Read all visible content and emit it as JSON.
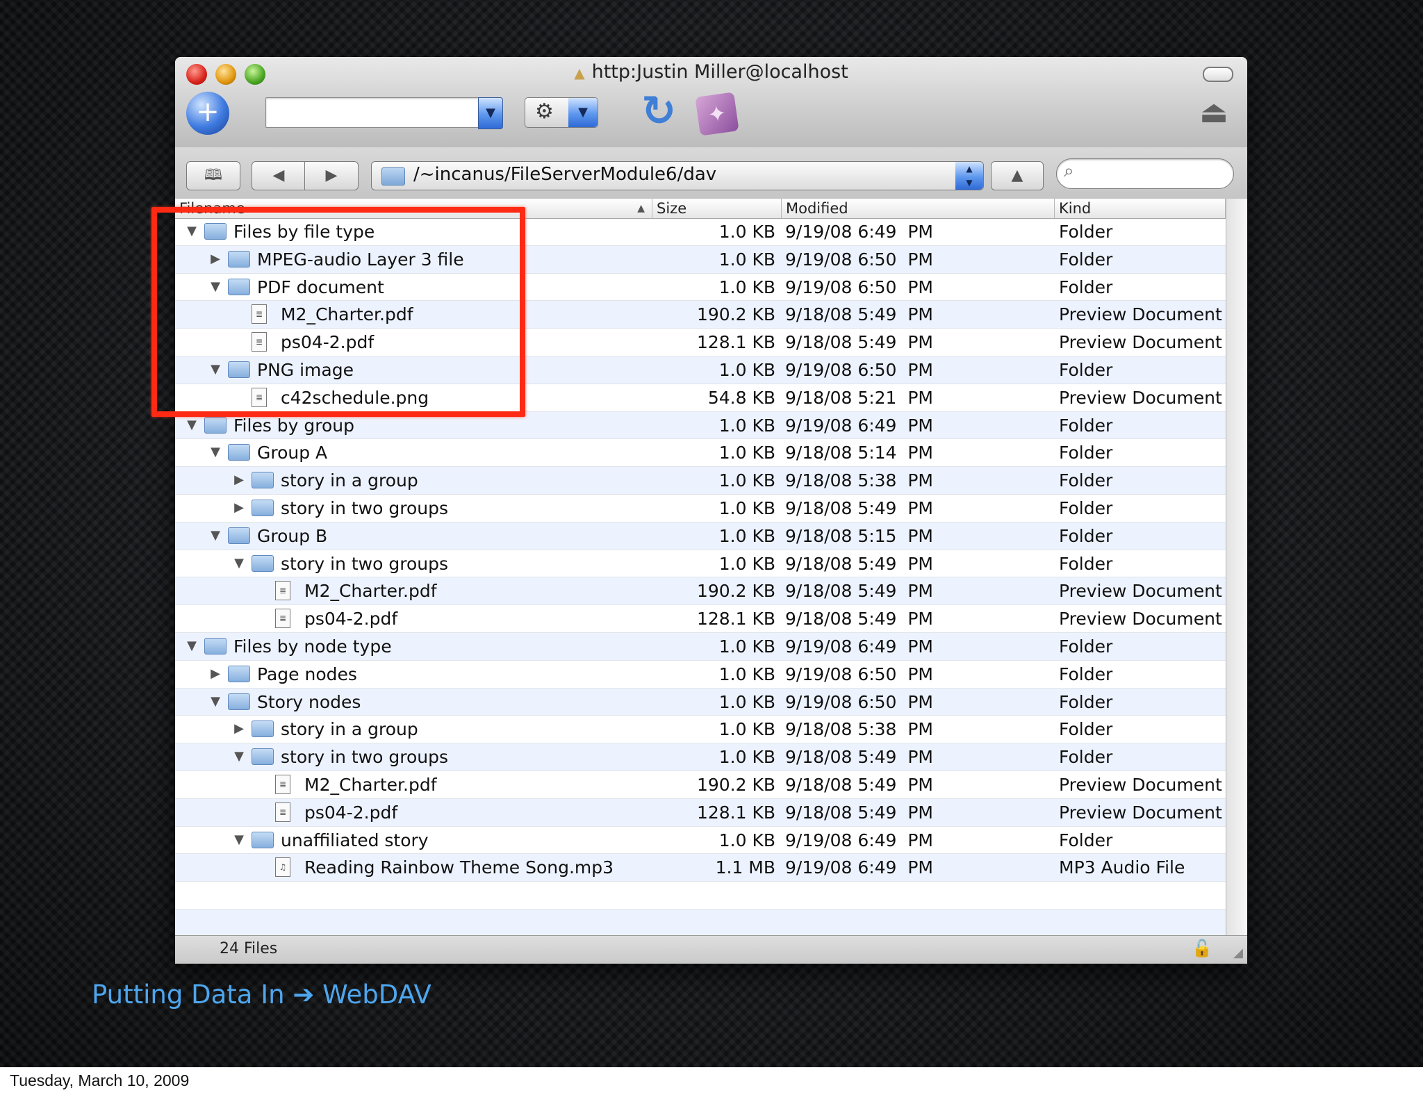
{
  "window": {
    "title": "http:Justin Miller@localhost",
    "path": "/~incanus/FileServerModule6/dav",
    "status": "24 Files"
  },
  "columns": {
    "filename": "Filename",
    "size": "Size",
    "modified": "Modified",
    "kind": "Kind"
  },
  "rows": [
    {
      "name": "Files by file type",
      "level": 0,
      "type": "folder",
      "expanded": true,
      "size": "1.0 KB",
      "modified": "9/19/08 6:49  PM",
      "kind": "Folder"
    },
    {
      "name": "MPEG-audio Layer 3 file",
      "level": 1,
      "type": "folder",
      "expanded": false,
      "size": "1.0 KB",
      "modified": "9/19/08 6:50  PM",
      "kind": "Folder"
    },
    {
      "name": "PDF document",
      "level": 1,
      "type": "folder",
      "expanded": true,
      "size": "1.0 KB",
      "modified": "9/19/08 6:50  PM",
      "kind": "Folder"
    },
    {
      "name": "M2_Charter.pdf",
      "level": 2,
      "type": "doc",
      "size": "190.2 KB",
      "modified": "9/18/08 5:49  PM",
      "kind": "Preview Document"
    },
    {
      "name": "ps04-2.pdf",
      "level": 2,
      "type": "doc",
      "size": "128.1 KB",
      "modified": "9/18/08 5:49  PM",
      "kind": "Preview Document"
    },
    {
      "name": "PNG image",
      "level": 1,
      "type": "folder",
      "expanded": true,
      "size": "1.0 KB",
      "modified": "9/19/08 6:50  PM",
      "kind": "Folder"
    },
    {
      "name": "c42schedule.png",
      "level": 2,
      "type": "doc",
      "size": "54.8 KB",
      "modified": "9/18/08 5:21  PM",
      "kind": "Preview Document"
    },
    {
      "name": "Files by group",
      "level": 0,
      "type": "folder",
      "expanded": true,
      "size": "1.0 KB",
      "modified": "9/19/08 6:49  PM",
      "kind": "Folder"
    },
    {
      "name": "Group A",
      "level": 1,
      "type": "folder",
      "expanded": true,
      "size": "1.0 KB",
      "modified": "9/18/08 5:14  PM",
      "kind": "Folder"
    },
    {
      "name": "story in a group",
      "level": 2,
      "type": "folder",
      "expanded": false,
      "size": "1.0 KB",
      "modified": "9/18/08 5:38  PM",
      "kind": "Folder"
    },
    {
      "name": "story in two groups",
      "level": 2,
      "type": "folder",
      "expanded": false,
      "size": "1.0 KB",
      "modified": "9/18/08 5:49  PM",
      "kind": "Folder"
    },
    {
      "name": "Group B",
      "level": 1,
      "type": "folder",
      "expanded": true,
      "size": "1.0 KB",
      "modified": "9/18/08 5:15  PM",
      "kind": "Folder"
    },
    {
      "name": "story in two groups",
      "level": 2,
      "type": "folder",
      "expanded": true,
      "size": "1.0 KB",
      "modified": "9/18/08 5:49  PM",
      "kind": "Folder"
    },
    {
      "name": "M2_Charter.pdf",
      "level": 3,
      "type": "doc",
      "size": "190.2 KB",
      "modified": "9/18/08 5:49  PM",
      "kind": "Preview Document"
    },
    {
      "name": "ps04-2.pdf",
      "level": 3,
      "type": "doc",
      "size": "128.1 KB",
      "modified": "9/18/08 5:49  PM",
      "kind": "Preview Document"
    },
    {
      "name": "Files by node type",
      "level": 0,
      "type": "folder",
      "expanded": true,
      "size": "1.0 KB",
      "modified": "9/19/08 6:49  PM",
      "kind": "Folder"
    },
    {
      "name": "Page nodes",
      "level": 1,
      "type": "folder",
      "expanded": false,
      "size": "1.0 KB",
      "modified": "9/19/08 6:50  PM",
      "kind": "Folder"
    },
    {
      "name": "Story nodes",
      "level": 1,
      "type": "folder",
      "expanded": true,
      "size": "1.0 KB",
      "modified": "9/19/08 6:50  PM",
      "kind": "Folder"
    },
    {
      "name": "story in a group",
      "level": 2,
      "type": "folder",
      "expanded": false,
      "size": "1.0 KB",
      "modified": "9/18/08 5:38  PM",
      "kind": "Folder"
    },
    {
      "name": "story in two groups",
      "level": 2,
      "type": "folder",
      "expanded": true,
      "size": "1.0 KB",
      "modified": "9/18/08 5:49  PM",
      "kind": "Folder"
    },
    {
      "name": "M2_Charter.pdf",
      "level": 3,
      "type": "doc",
      "size": "190.2 KB",
      "modified": "9/18/08 5:49  PM",
      "kind": "Preview Document"
    },
    {
      "name": "ps04-2.pdf",
      "level": 3,
      "type": "doc",
      "size": "128.1 KB",
      "modified": "9/18/08 5:49  PM",
      "kind": "Preview Document"
    },
    {
      "name": "unaffiliated story",
      "level": 2,
      "type": "folder",
      "expanded": true,
      "size": "1.0 KB",
      "modified": "9/19/08 6:49  PM",
      "kind": "Folder"
    },
    {
      "name": "Reading Rainbow Theme Song.mp3",
      "level": 3,
      "type": "audio",
      "size": "1.1 MB",
      "modified": "9/19/08 6:49  PM",
      "kind": "MP3 Audio File"
    }
  ],
  "slide": {
    "caption": "Putting Data In ➔ WebDAV",
    "date": "Tuesday, March 10, 2009"
  },
  "colors": {
    "highlight": "#ff2a14",
    "caption": "#4ea6ee"
  }
}
